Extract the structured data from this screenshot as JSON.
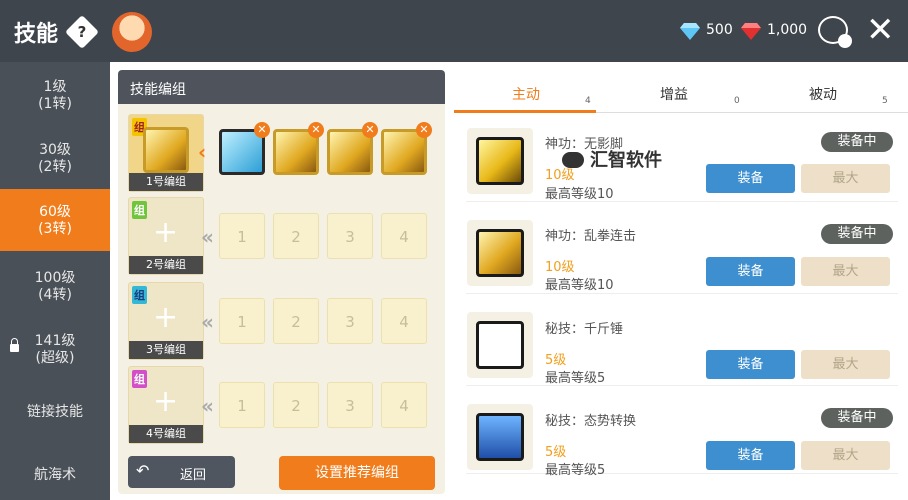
{
  "header": {
    "title": "技能",
    "help": "?",
    "diamonds": "500",
    "rubies": "1,000",
    "close": "✕"
  },
  "sidebar": [
    {
      "line1": "1级",
      "line2": "(1转)"
    },
    {
      "line1": "30级",
      "line2": "(2转)"
    },
    {
      "line1": "60级",
      "line2": "(3转)",
      "active": true
    },
    {
      "line1": "100级",
      "line2": "(4转)"
    },
    {
      "line1": "141级",
      "line2": "(超级)",
      "locked": true
    },
    {
      "line1": "链接技能",
      "line2": ""
    },
    {
      "line1": "航海术",
      "line2": ""
    }
  ],
  "skill_groups": {
    "title": "技能编组",
    "badge": "组",
    "groups": [
      {
        "name": "1号编组",
        "slots": [
          "",
          "",
          "",
          ""
        ]
      },
      {
        "name": "2号编组",
        "slots": [
          "1",
          "2",
          "3",
          "4"
        ]
      },
      {
        "name": "3号编组",
        "slots": [
          "1",
          "2",
          "3",
          "4"
        ]
      },
      {
        "name": "4号编组",
        "slots": [
          "1",
          "2",
          "3",
          "4"
        ]
      }
    ],
    "back_label": "返回",
    "recommend_label": "设置推荐编组"
  },
  "tabs": [
    {
      "label": "主动",
      "count": "4",
      "active": true
    },
    {
      "label": "增益",
      "count": "0"
    },
    {
      "label": "被动",
      "count": "5"
    }
  ],
  "skills": [
    {
      "name": "神功：无影脚",
      "level": "10级",
      "max": "最高等级10",
      "equipped": "装备中",
      "equip": "装备",
      "maxbtn": "最大"
    },
    {
      "name": "神功：乱拳连击",
      "level": "10级",
      "max": "最高等级10",
      "equipped": "装备中",
      "equip": "装备",
      "maxbtn": "最大"
    },
    {
      "name": "秘技：千斤锤",
      "level": "5级",
      "max": "最高等级5",
      "equipped": "",
      "equip": "装备",
      "maxbtn": "最大"
    },
    {
      "name": "秘技：态势转换",
      "level": "5级",
      "max": "最高等级5",
      "equipped": "装备中",
      "equip": "装备",
      "maxbtn": "最大"
    }
  ],
  "watermark": "汇智软件",
  "colors": {
    "accent": "#f07c1b",
    "equip_blue": "#3e8fd0",
    "sidebar": "#4a5058"
  }
}
